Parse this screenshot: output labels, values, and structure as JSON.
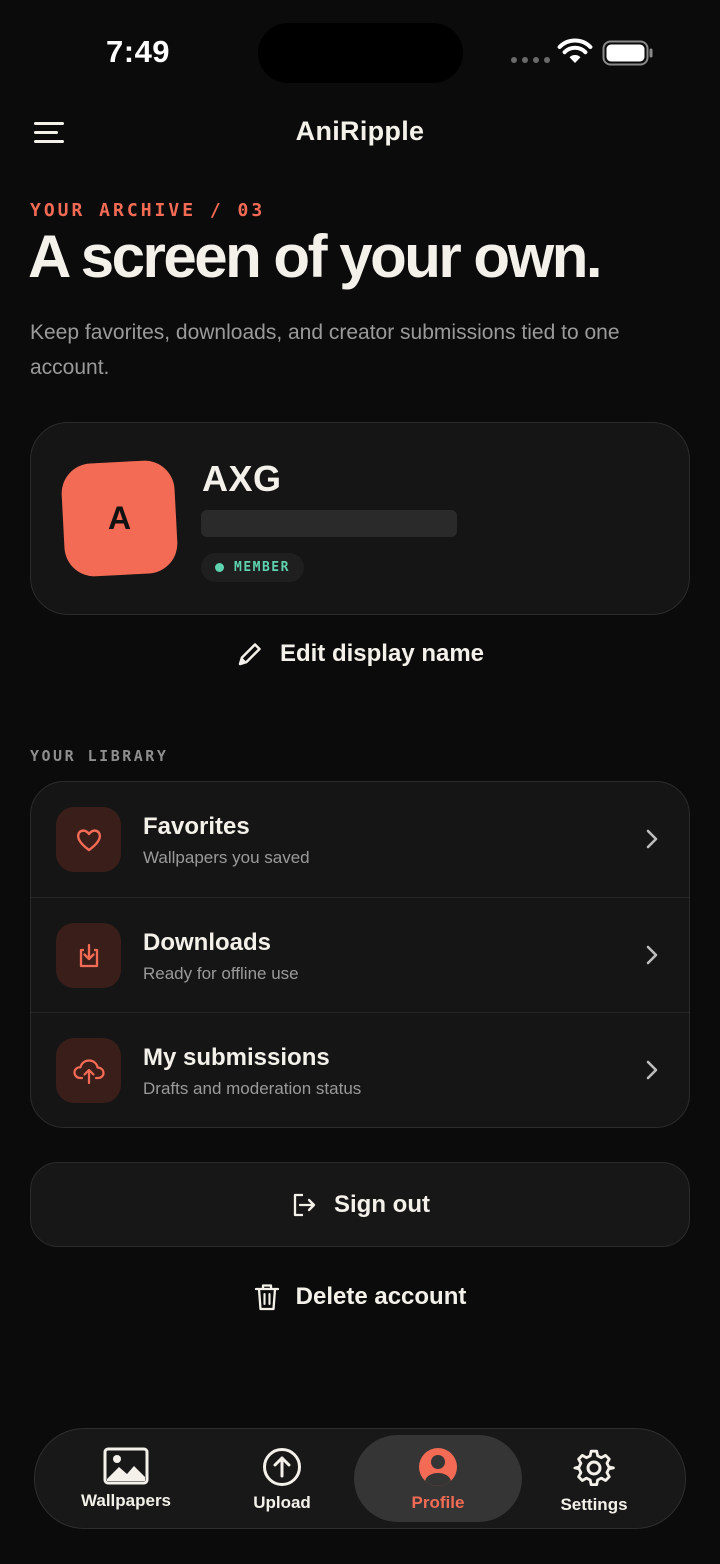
{
  "status_bar": {
    "time": "7:49"
  },
  "header": {
    "app_title": "AniRipple"
  },
  "hero": {
    "eyebrow": "YOUR ARCHIVE / 03",
    "headline": "A screen of your own.",
    "subtext": "Keep favorites, downloads, and creator submissions tied to one account."
  },
  "profile": {
    "avatar_letter": "A",
    "display_name": "AXG",
    "badge": "MEMBER",
    "edit_label": "Edit display name"
  },
  "library": {
    "section_label": "YOUR LIBRARY",
    "items": [
      {
        "title": "Favorites",
        "subtitle": "Wallpapers you saved",
        "icon": "heart-icon"
      },
      {
        "title": "Downloads",
        "subtitle": "Ready for offline use",
        "icon": "download-icon"
      },
      {
        "title": "My submissions",
        "subtitle": "Drafts and moderation status",
        "icon": "cloud-upload-icon"
      }
    ]
  },
  "actions": {
    "sign_out": "Sign out",
    "delete_account": "Delete account"
  },
  "tabs": [
    {
      "label": "Wallpapers",
      "icon": "image-icon",
      "active": false
    },
    {
      "label": "Upload",
      "icon": "upload-icon",
      "active": false
    },
    {
      "label": "Profile",
      "icon": "profile-icon",
      "active": true
    },
    {
      "label": "Settings",
      "icon": "gear-icon",
      "active": false
    }
  ],
  "colors": {
    "accent": "#f36b55",
    "background": "#0b0b0b",
    "card": "#151515",
    "member": "#5fd3b0",
    "text": "#f4f1ea",
    "muted": "#9a9a9a"
  }
}
